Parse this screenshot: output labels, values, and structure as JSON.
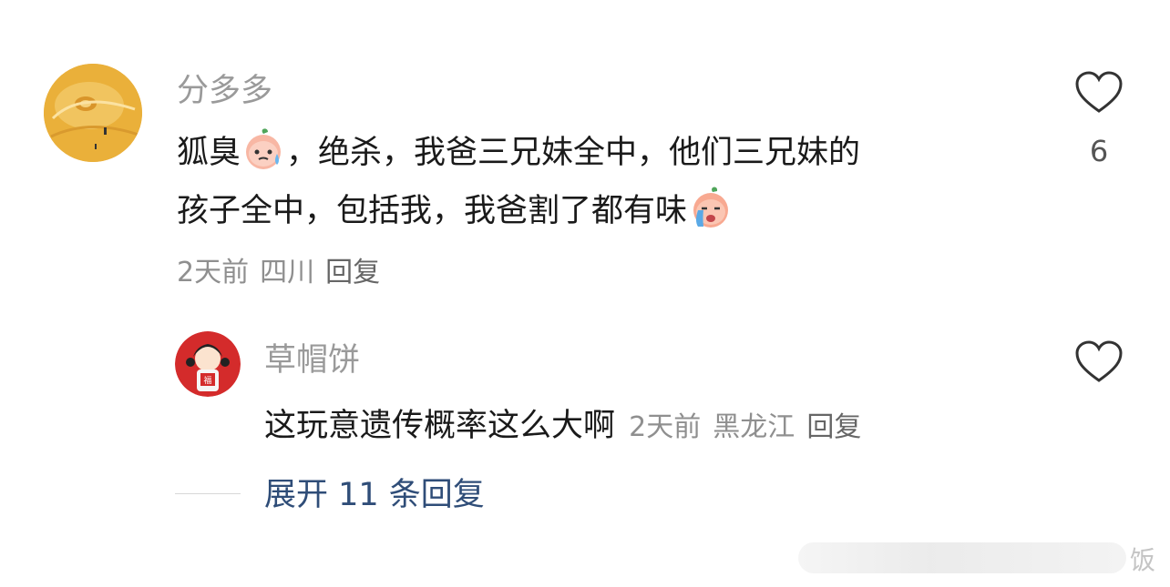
{
  "comment": {
    "username": "分多多",
    "line1_a": "狐臭",
    "line1_b": "，绝杀，我爸三兄妹全中，他们三兄妹的",
    "line2": "孩子全中，包括我，我爸割了都有味",
    "emoji1": "sweat-peach-emoji",
    "emoji2": "crying-peach-emoji",
    "time": "2天前",
    "location": "四川",
    "reply_label": "回复",
    "likes": "6"
  },
  "reply": {
    "username": "草帽饼",
    "text": "这玩意遗传概率这么大啊",
    "time": "2天前",
    "location": "黑龙江",
    "reply_label": "回复"
  },
  "expand_label": "展开 11 条回复",
  "watermark": "饭",
  "colors": {
    "username": "#9a9a9a",
    "text": "#1a1a1a",
    "meta": "#8f8f8f",
    "link": "#2f4d78"
  }
}
